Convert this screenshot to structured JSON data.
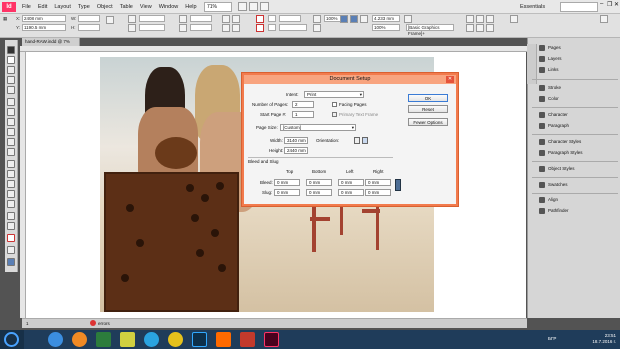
{
  "app": {
    "logo": "Id",
    "zoom": "71%",
    "workspace": "Essentials",
    "window_controls": [
      "–",
      "❐",
      "✕"
    ]
  },
  "menu": [
    "File",
    "Edit",
    "Layout",
    "Type",
    "Object",
    "Table",
    "View",
    "Window",
    "Help"
  ],
  "control_bar": {
    "x_value": "2408 mm",
    "y_value": "1190.5 mm",
    "w_value": "",
    "h_value": "",
    "stroke_weight": "",
    "percent": "100%",
    "size_value": "4.233 mm",
    "frame_style": "[Basic Graphics Frame]+",
    "zoom_pct": "100%"
  },
  "document": {
    "tab_title": "hand-RAW.indd @ 7%"
  },
  "dialog": {
    "title": "Document Setup",
    "intent_label": "Intent:",
    "intent_value": "Print",
    "pages_label": "Number of Pages:",
    "pages_value": "2",
    "start_label": "Start Page #:",
    "start_value": "1",
    "facing_label": "Facing Pages",
    "primary_label": "Primary Text Frame",
    "size_label": "Page Size:",
    "size_value": "[Custom]",
    "width_label": "Width:",
    "width_value": "3140 mm",
    "height_label": "Height:",
    "height_value": "2440 mm",
    "orientation_label": "Orientation:",
    "bleed_section": "Bleed and Slug",
    "col_top": "Top",
    "col_bottom": "Bottom",
    "col_left": "Left",
    "col_right": "Right",
    "bleed_label": "Bleed:",
    "slug_label": "Slug:",
    "bleed_values": [
      "0 mm",
      "0 mm",
      "0 mm",
      "0 mm"
    ],
    "slug_values": [
      "0 mm",
      "0 mm",
      "0 mm",
      "0 mm"
    ],
    "ok": "OK",
    "reset": "Reset",
    "fewer": "Fewer Options"
  },
  "panels": [
    "Pages",
    "Layers",
    "Links",
    "Stroke",
    "Color",
    "Character",
    "Paragraph",
    "Character Styles",
    "Paragraph Styles",
    "Object Styles",
    "Swatches",
    "Align",
    "Pathfinder"
  ],
  "status": {
    "page": "1",
    "errors": "errors"
  },
  "taskbar": {
    "lang": "БГР",
    "time": "23:51",
    "date": "18.7.2016 г."
  },
  "colors": {
    "dialog_border": "#f27b4d",
    "dialog_title_bg": "#f8a47f",
    "taskbar": "#1f3c5a",
    "indesign_pink": "#ff3366"
  }
}
